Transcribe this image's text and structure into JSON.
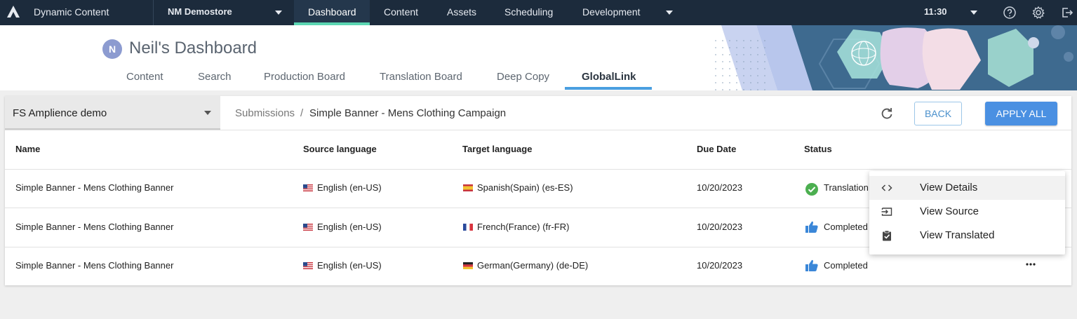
{
  "topbar": {
    "app_title": "Dynamic Content",
    "hub_name": "NM Demostore",
    "nav": [
      "Dashboard",
      "Content",
      "Assets",
      "Scheduling",
      "Development"
    ],
    "active_nav": "Dashboard",
    "time": "11:30",
    "colors": {
      "bg": "#1c2b3c",
      "accent": "#5bd6b2"
    }
  },
  "header": {
    "avatar_initial": "N",
    "title": "Neil's Dashboard",
    "tabs": [
      "Content",
      "Search",
      "Production Board",
      "Translation Board",
      "Deep Copy",
      "GlobalLink"
    ],
    "active_tab": "GlobalLink"
  },
  "toolbar": {
    "hub_select": "FS Amplience demo",
    "breadcrumb_root": "Submissions",
    "breadcrumb_sep": "/",
    "breadcrumb_current": "Simple Banner - Mens Clothing Campaign",
    "back_label": "BACK",
    "apply_all_label": "APPLY ALL"
  },
  "table": {
    "headers": [
      "Name",
      "Source language",
      "Target language",
      "Due Date",
      "Status"
    ],
    "rows": [
      {
        "name": "Simple Banner - Mens Clothing Banner",
        "source": "English (en-US)",
        "target": "Spanish(Spain) (es-ES)",
        "due": "10/20/2023",
        "status": "Translation",
        "status_icon": "check-circle-icon"
      },
      {
        "name": "Simple Banner - Mens Clothing Banner",
        "source": "English (en-US)",
        "target": "French(France) (fr-FR)",
        "due": "10/20/2023",
        "status": "Completed",
        "status_icon": "thumbs-up-icon"
      },
      {
        "name": "Simple Banner - Mens Clothing Banner",
        "source": "English (en-US)",
        "target": "German(Germany) (de-DE)",
        "due": "10/20/2023",
        "status": "Completed",
        "status_icon": "thumbs-up-icon"
      }
    ]
  },
  "context_menu": {
    "items": [
      {
        "label": "View Details",
        "icon": "code-icon"
      },
      {
        "label": "View Source",
        "icon": "import-icon"
      },
      {
        "label": "View Translated",
        "icon": "clipboard-check-icon"
      }
    ]
  }
}
